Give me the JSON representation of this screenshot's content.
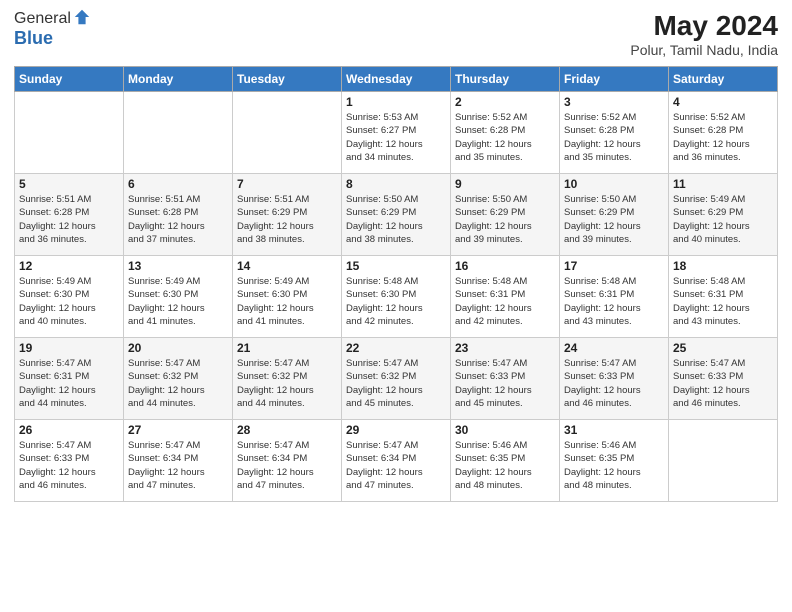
{
  "logo": {
    "general": "General",
    "blue": "Blue"
  },
  "title": "May 2024",
  "subtitle": "Polur, Tamil Nadu, India",
  "weekdays": [
    "Sunday",
    "Monday",
    "Tuesday",
    "Wednesday",
    "Thursday",
    "Friday",
    "Saturday"
  ],
  "weeks": [
    [
      {
        "day": "",
        "info": ""
      },
      {
        "day": "",
        "info": ""
      },
      {
        "day": "",
        "info": ""
      },
      {
        "day": "1",
        "info": "Sunrise: 5:53 AM\nSunset: 6:27 PM\nDaylight: 12 hours\nand 34 minutes."
      },
      {
        "day": "2",
        "info": "Sunrise: 5:52 AM\nSunset: 6:28 PM\nDaylight: 12 hours\nand 35 minutes."
      },
      {
        "day": "3",
        "info": "Sunrise: 5:52 AM\nSunset: 6:28 PM\nDaylight: 12 hours\nand 35 minutes."
      },
      {
        "day": "4",
        "info": "Sunrise: 5:52 AM\nSunset: 6:28 PM\nDaylight: 12 hours\nand 36 minutes."
      }
    ],
    [
      {
        "day": "5",
        "info": "Sunrise: 5:51 AM\nSunset: 6:28 PM\nDaylight: 12 hours\nand 36 minutes."
      },
      {
        "day": "6",
        "info": "Sunrise: 5:51 AM\nSunset: 6:28 PM\nDaylight: 12 hours\nand 37 minutes."
      },
      {
        "day": "7",
        "info": "Sunrise: 5:51 AM\nSunset: 6:29 PM\nDaylight: 12 hours\nand 38 minutes."
      },
      {
        "day": "8",
        "info": "Sunrise: 5:50 AM\nSunset: 6:29 PM\nDaylight: 12 hours\nand 38 minutes."
      },
      {
        "day": "9",
        "info": "Sunrise: 5:50 AM\nSunset: 6:29 PM\nDaylight: 12 hours\nand 39 minutes."
      },
      {
        "day": "10",
        "info": "Sunrise: 5:50 AM\nSunset: 6:29 PM\nDaylight: 12 hours\nand 39 minutes."
      },
      {
        "day": "11",
        "info": "Sunrise: 5:49 AM\nSunset: 6:29 PM\nDaylight: 12 hours\nand 40 minutes."
      }
    ],
    [
      {
        "day": "12",
        "info": "Sunrise: 5:49 AM\nSunset: 6:30 PM\nDaylight: 12 hours\nand 40 minutes."
      },
      {
        "day": "13",
        "info": "Sunrise: 5:49 AM\nSunset: 6:30 PM\nDaylight: 12 hours\nand 41 minutes."
      },
      {
        "day": "14",
        "info": "Sunrise: 5:49 AM\nSunset: 6:30 PM\nDaylight: 12 hours\nand 41 minutes."
      },
      {
        "day": "15",
        "info": "Sunrise: 5:48 AM\nSunset: 6:30 PM\nDaylight: 12 hours\nand 42 minutes."
      },
      {
        "day": "16",
        "info": "Sunrise: 5:48 AM\nSunset: 6:31 PM\nDaylight: 12 hours\nand 42 minutes."
      },
      {
        "day": "17",
        "info": "Sunrise: 5:48 AM\nSunset: 6:31 PM\nDaylight: 12 hours\nand 43 minutes."
      },
      {
        "day": "18",
        "info": "Sunrise: 5:48 AM\nSunset: 6:31 PM\nDaylight: 12 hours\nand 43 minutes."
      }
    ],
    [
      {
        "day": "19",
        "info": "Sunrise: 5:47 AM\nSunset: 6:31 PM\nDaylight: 12 hours\nand 44 minutes."
      },
      {
        "day": "20",
        "info": "Sunrise: 5:47 AM\nSunset: 6:32 PM\nDaylight: 12 hours\nand 44 minutes."
      },
      {
        "day": "21",
        "info": "Sunrise: 5:47 AM\nSunset: 6:32 PM\nDaylight: 12 hours\nand 44 minutes."
      },
      {
        "day": "22",
        "info": "Sunrise: 5:47 AM\nSunset: 6:32 PM\nDaylight: 12 hours\nand 45 minutes."
      },
      {
        "day": "23",
        "info": "Sunrise: 5:47 AM\nSunset: 6:33 PM\nDaylight: 12 hours\nand 45 minutes."
      },
      {
        "day": "24",
        "info": "Sunrise: 5:47 AM\nSunset: 6:33 PM\nDaylight: 12 hours\nand 46 minutes."
      },
      {
        "day": "25",
        "info": "Sunrise: 5:47 AM\nSunset: 6:33 PM\nDaylight: 12 hours\nand 46 minutes."
      }
    ],
    [
      {
        "day": "26",
        "info": "Sunrise: 5:47 AM\nSunset: 6:33 PM\nDaylight: 12 hours\nand 46 minutes."
      },
      {
        "day": "27",
        "info": "Sunrise: 5:47 AM\nSunset: 6:34 PM\nDaylight: 12 hours\nand 47 minutes."
      },
      {
        "day": "28",
        "info": "Sunrise: 5:47 AM\nSunset: 6:34 PM\nDaylight: 12 hours\nand 47 minutes."
      },
      {
        "day": "29",
        "info": "Sunrise: 5:47 AM\nSunset: 6:34 PM\nDaylight: 12 hours\nand 47 minutes."
      },
      {
        "day": "30",
        "info": "Sunrise: 5:46 AM\nSunset: 6:35 PM\nDaylight: 12 hours\nand 48 minutes."
      },
      {
        "day": "31",
        "info": "Sunrise: 5:46 AM\nSunset: 6:35 PM\nDaylight: 12 hours\nand 48 minutes."
      },
      {
        "day": "",
        "info": ""
      }
    ]
  ]
}
